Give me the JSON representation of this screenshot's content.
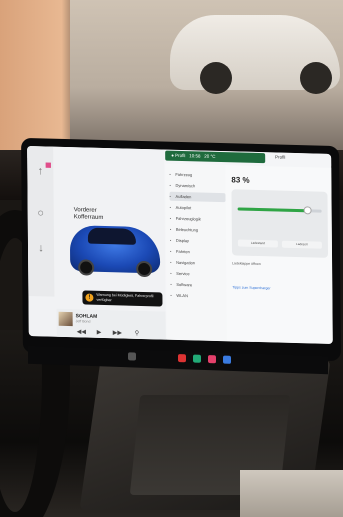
{
  "status": {
    "battery": "83 %",
    "profile": "Profil",
    "time": "10:58",
    "temp": "20 °C"
  },
  "car_view": {
    "trunk_label": "Vorderer Kofferraum",
    "warning": "Warnung bei Müdigkeit, Fahrerprofil verfügbar"
  },
  "media": {
    "title": "SOHLAM",
    "subtitle": "Jeff Bond"
  },
  "menu": {
    "items": [
      {
        "label": "Fahrzeug"
      },
      {
        "label": "Dynamisch"
      },
      {
        "label": "Aufladen"
      },
      {
        "label": "Autopilot"
      },
      {
        "label": "Fahrzeuglogik"
      },
      {
        "label": "Beleuchtung"
      },
      {
        "label": "Display"
      },
      {
        "label": "Fahrten"
      },
      {
        "label": "Navigation"
      },
      {
        "label": "Service"
      },
      {
        "label": "Software"
      },
      {
        "label": "WLAN"
      }
    ],
    "active_index": 2
  },
  "charging": {
    "level": "83 %",
    "limit_fraction": 0.83,
    "button_left": "Ladestand",
    "button_right": "Ladezeit",
    "note": "Ladeklappe öffnen",
    "link": "Tipps zum Supercharger"
  }
}
